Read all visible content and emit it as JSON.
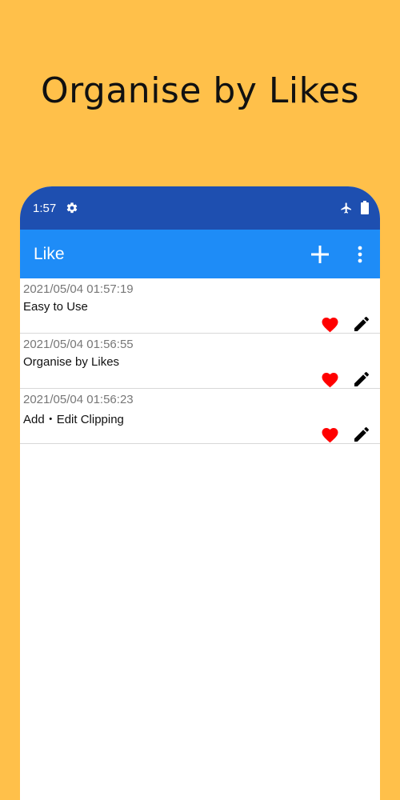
{
  "headline": "Organise by Likes",
  "status_bar": {
    "time": "1:57",
    "icons": [
      "gear-icon",
      "airplane-icon",
      "battery-icon"
    ]
  },
  "app_bar": {
    "title": "Like",
    "actions": [
      "add-icon",
      "more-vert-icon"
    ]
  },
  "colors": {
    "background": "#FFC04A",
    "status_bar": "#1E4FB0",
    "app_bar": "#1E8CF7",
    "heart": "#FF0000"
  },
  "items": [
    {
      "date": "2021/05/04 01:57:19",
      "title": "Easy to Use"
    },
    {
      "date": "2021/05/04 01:56:55",
      "title": "Organise by Likes"
    },
    {
      "date": "2021/05/04 01:56:23",
      "title": "Add・Edit Clipping"
    }
  ]
}
